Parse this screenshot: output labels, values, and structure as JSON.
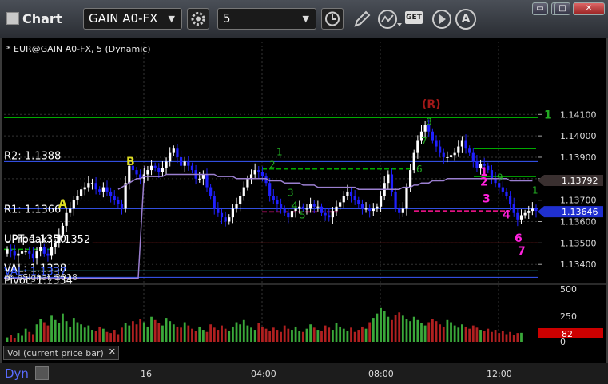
{
  "window": {
    "title": "Chart",
    "symbol_combo": "GAIN A0-FX",
    "interval_combo": "5",
    "get_button": "GET",
    "font_button": "A"
  },
  "chart_header": "* EUR@GAIN A0-FX, 5 (Dynamic)",
  "copyright": "© eSignal, 2018",
  "volume_label": "Vol (current price bar)",
  "dyn_label": "Dyn",
  "colors": {
    "background": "#000000",
    "up_candle": "#ffffff",
    "down_candle": "#2020ff",
    "resistance": "#00aa00",
    "support": "#ff1493",
    "moving_average": "#9b7fd0",
    "price_tag": "#2030d0",
    "ma_tag": "#ff2020"
  },
  "chart_data": {
    "type": "candlestick",
    "y_ticks": [
      1.141,
      1.14,
      1.139,
      1.138,
      1.137,
      1.136,
      1.135,
      1.134
    ],
    "y_tick_labels": [
      "1.14100",
      "1.14000",
      "1.13900",
      "1.13800",
      "1.13700",
      "1.13600",
      "1.13500",
      "1.13400"
    ],
    "ylim": [
      1.1333,
      1.1444
    ],
    "x_tick_labels": [
      "16",
      "04:00",
      "08:00",
      "12:00"
    ],
    "last_price": "1.13646",
    "ma_value": "1.13792",
    "volume_ticks": [
      "500",
      "250",
      "0"
    ],
    "volume_last": "82",
    "pivot_levels": [
      {
        "label": "R2: 1.1388",
        "value": 1.1388
      },
      {
        "label": "R1: 1.1366",
        "value": 1.1366
      },
      {
        "label": "UPT: 1.1350",
        "value": 1.135
      },
      {
        "label": "VAL: 1.1337",
        "value": 1.1337
      },
      {
        "label": "Pivot: 1.1334",
        "value": 1.1334
      }
    ],
    "overlapped_labels": [
      "UPrpeak: 1.1352",
      "VAL: 1.1338",
      "VAL: 1.1337"
    ],
    "annotations": [
      {
        "text": "A",
        "color": "#dddd22"
      },
      {
        "text": "B",
        "color": "#dddd22"
      },
      {
        "text": "(R)",
        "color": "#a01818"
      },
      {
        "text": "1",
        "color": "#22aa22"
      },
      {
        "text": "1",
        "color": "#ff22dd"
      },
      {
        "text": "2",
        "color": "#ff22dd"
      },
      {
        "text": "3",
        "color": "#ff22dd"
      },
      {
        "text": "4",
        "color": "#ff22dd"
      },
      {
        "text": "6",
        "color": "#ff22dd"
      },
      {
        "text": "7",
        "color": "#ff22dd"
      }
    ],
    "series": [
      {
        "name": "price",
        "values": [
          1.1347,
          1.1346,
          1.1344,
          1.1345,
          1.1346,
          1.1346,
          1.1345,
          1.1343,
          1.1346,
          1.1348,
          1.1345,
          1.1344,
          1.1348,
          1.135,
          1.1354,
          1.1358,
          1.1364,
          1.1366,
          1.137,
          1.1372,
          1.1375,
          1.1376,
          1.1378,
          1.1378,
          1.1375,
          1.1374,
          1.1376,
          1.1374,
          1.1372,
          1.137,
          1.1368,
          1.1366,
          1.1378,
          1.1386,
          1.1384,
          1.1382,
          1.138,
          1.1382,
          1.1384,
          1.1386,
          1.1385,
          1.1383,
          1.1385,
          1.1388,
          1.1392,
          1.1394,
          1.139,
          1.1386,
          1.1388,
          1.1386,
          1.1384,
          1.138,
          1.138,
          1.1382,
          1.1376,
          1.1372,
          1.1366,
          1.1364,
          1.1362,
          1.136,
          1.1362,
          1.1366,
          1.1368,
          1.1372,
          1.1376,
          1.138,
          1.1382,
          1.1384,
          1.1383,
          1.1381,
          1.1378,
          1.1372,
          1.137,
          1.1368,
          1.1366,
          1.1364,
          1.1362,
          1.1365,
          1.1366,
          1.1367,
          1.1366,
          1.1366,
          1.1368,
          1.1367,
          1.1367,
          1.1364,
          1.1363,
          1.1362,
          1.1365,
          1.1367,
          1.1369,
          1.1372,
          1.1374,
          1.1372,
          1.137,
          1.1368,
          1.1366,
          1.1366,
          1.1365,
          1.1366,
          1.1367,
          1.1372,
          1.1378,
          1.1382,
          1.1374,
          1.1366,
          1.1364,
          1.1366,
          1.1376,
          1.1384,
          1.1392,
          1.1398,
          1.1402,
          1.1405,
          1.1402,
          1.1398,
          1.1395,
          1.1392,
          1.139,
          1.139,
          1.1391,
          1.1392,
          1.1395,
          1.1398,
          1.1394,
          1.1392,
          1.1388,
          1.1385,
          1.1387,
          1.1386,
          1.1384,
          1.138,
          1.1378,
          1.1376,
          1.1374,
          1.1372,
          1.1368,
          1.1364,
          1.1361,
          1.1363,
          1.1364,
          1.1365,
          1.1366,
          1.1365
        ]
      },
      {
        "name": "moving_average",
        "values": [
          1.1335,
          1.1335,
          1.1336,
          1.1336,
          1.1336,
          1.1337,
          1.1337,
          1.1338,
          1.1338,
          1.1339,
          1.134,
          1.1341,
          1.1342,
          1.1343,
          1.1344,
          1.1346,
          1.1347,
          1.1349,
          1.1351,
          1.1353,
          1.1356,
          1.1358,
          1.136,
          1.1362,
          1.1364,
          1.1366,
          1.1368,
          1.137,
          1.1372,
          1.1374,
          1.1375,
          1.1376,
          1.1377,
          1.1378,
          1.1379,
          1.138,
          1.138,
          1.1381,
          1.1381,
          1.1381,
          1.1381,
          1.1381,
          1.1381,
          1.1382,
          1.1382,
          1.1382,
          1.1382,
          1.1382,
          1.1382,
          1.1382,
          1.1382,
          1.1382,
          1.1382,
          1.1382,
          1.1382,
          1.1382,
          1.1382,
          1.1381,
          1.1381,
          1.1381,
          1.1381,
          1.1381,
          1.138,
          1.138,
          1.138,
          1.138,
          1.138,
          1.138,
          1.138,
          1.138,
          1.138,
          1.1379,
          1.1379,
          1.1379,
          1.1379,
          1.1378,
          1.1378,
          1.1378,
          1.1378,
          1.1378,
          1.1377,
          1.1377,
          1.1377,
          1.1377,
          1.1376,
          1.1376,
          1.1376,
          1.1376,
          1.1376,
          1.1376,
          1.1376,
          1.1376,
          1.1376,
          1.1376,
          1.1376,
          1.1375,
          1.1375,
          1.1375,
          1.1375,
          1.1375,
          1.1375,
          1.1375,
          1.1375,
          1.1375,
          1.1375,
          1.1375,
          1.1375,
          1.1376,
          1.1376,
          1.1376,
          1.1377,
          1.1377,
          1.1378,
          1.1378,
          1.1378,
          1.1379,
          1.1379,
          1.1379,
          1.1379,
          1.138,
          1.138,
          1.138,
          1.138,
          1.138,
          1.138,
          1.138,
          1.138,
          1.138,
          1.138,
          1.138,
          1.138,
          1.138,
          1.138,
          1.138,
          1.138,
          1.138,
          1.1379,
          1.1379,
          1.1379,
          1.1379,
          1.1379,
          1.1379,
          1.1379
        ]
      },
      {
        "name": "volume",
        "values": [
          40,
          60,
          35,
          80,
          55,
          120,
          90,
          70,
          160,
          210,
          180,
          150,
          240,
          200,
          170,
          260,
          190,
          140,
          220,
          180,
          160,
          130,
          150,
          110,
          100,
          140,
          120,
          90,
          80,
          110,
          70,
          130,
          170,
          150,
          190,
          160,
          210,
          180,
          140,
          230,
          200,
          170,
          150,
          220,
          190,
          160,
          140,
          130,
          180,
          150,
          120,
          100,
          140,
          110,
          90,
          160,
          130,
          110,
          150,
          120,
          100,
          140,
          180,
          160,
          200,
          150,
          130,
          110,
          170,
          140,
          120,
          100,
          130,
          110,
          90,
          150,
          120,
          110,
          140,
          100,
          90,
          120,
          160,
          130,
          110,
          100,
          150,
          130,
          110,
          170,
          140,
          120,
          100,
          130,
          90,
          110,
          140,
          120,
          180,
          220,
          260,
          310,
          280,
          230,
          200,
          250,
          270,
          240,
          210,
          190,
          230,
          200,
          170,
          150,
          180,
          210,
          190,
          160,
          140,
          200,
          180,
          150,
          130,
          160,
          140,
          120,
          150,
          130,
          110,
          100,
          120,
          90,
          110,
          80,
          100,
          70,
          90,
          60,
          80,
          82
        ]
      }
    ]
  }
}
